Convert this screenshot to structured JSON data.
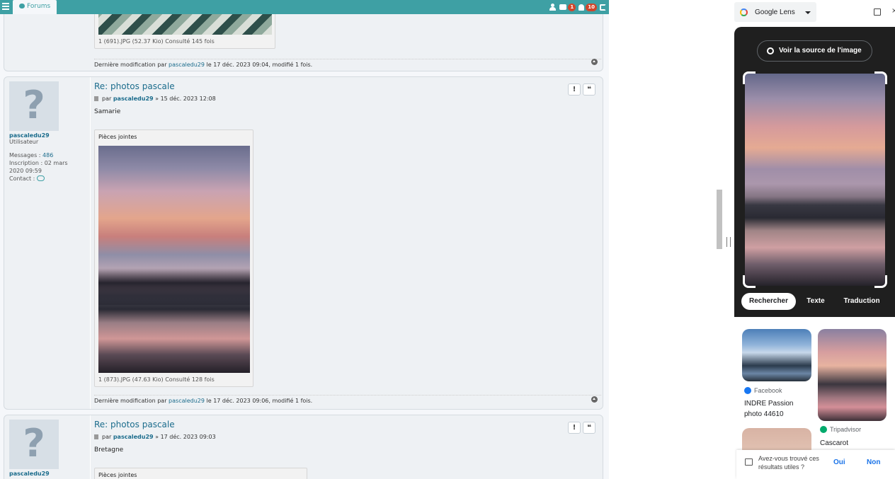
{
  "topbar": {
    "forums_tab": "Forums",
    "inbox_count": "1",
    "notif_count": "10"
  },
  "post0": {
    "attachment_caption": "1 (691).JPG (52.37 Kio) Consulté 145 fois",
    "last_mod_prefix": "Dernière modification par",
    "last_mod_user": "pascaledu29",
    "last_mod_suffix": "le 17 déc. 2023 09:04, modifié 1 fois."
  },
  "post1": {
    "username": "pascaledu29",
    "role": "Utilisateur",
    "messages_label": "Messages :",
    "messages_count": "486",
    "inscription": "Inscription : 02 mars 2020 09:59",
    "contact_label": "Contact :",
    "title": "Re: photos pascale",
    "by_prefix": "par",
    "author": "pascaledu29",
    "date": "» 15 déc. 2023 12:08",
    "text": "Samarie",
    "attachments_header": "Pièces jointes",
    "attachment_caption": "1 (873).JPG (47.63 Kio) Consulté 128 fois",
    "last_mod_prefix": "Dernière modification par",
    "last_mod_user": "pascaledu29",
    "last_mod_suffix": "le 17 déc. 2023 09:06, modifié 1 fois.",
    "report_glyph": "!",
    "quote_glyph": "❝"
  },
  "post2": {
    "username": "pascaledu29",
    "title": "Re: photos pascale",
    "by_prefix": "par",
    "author": "pascaledu29",
    "date": "» 17 déc. 2023 09:03",
    "text": "Bretagne",
    "attachments_header": "Pièces jointes",
    "report_glyph": "!",
    "quote_glyph": "❝"
  },
  "lens": {
    "title": "Google Lens",
    "source_button": "Voir la source de l'image",
    "tabs": [
      "Rechercher",
      "Texte",
      "Traduction"
    ],
    "results": [
      {
        "source": "Facebook",
        "title": "INDRE Passion photo 44610"
      },
      {
        "source": "Tripadvisor",
        "title": "Cascarot"
      }
    ],
    "feedback_question": "Avez-vous trouvé ces résultats utiles ?",
    "feedback_yes": "Oui",
    "feedback_no": "Non",
    "colors": {
      "facebook": "#1877f2",
      "tripadvisor": "#00aa6c",
      "accent": "#1a73e8"
    }
  }
}
